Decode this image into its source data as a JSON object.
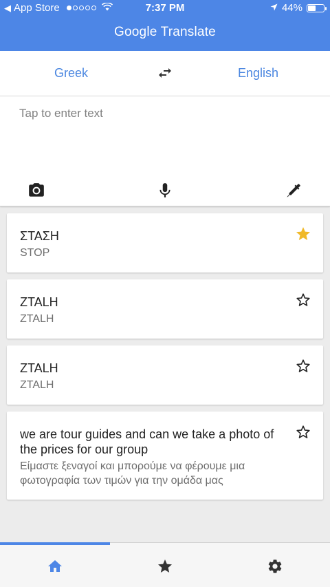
{
  "status_bar": {
    "carrier": "App Store",
    "time": "7:37 PM",
    "battery": "44%",
    "battery_level": 0.44,
    "signal_bars_filled": 1,
    "signal_bars_total": 5
  },
  "app": {
    "title": "Google Translate"
  },
  "languages": {
    "source": "Greek",
    "target": "English"
  },
  "input": {
    "placeholder": "Tap to enter text"
  },
  "tools": {
    "camera_icon": "camera-icon",
    "mic_icon": "microphone-icon",
    "handwriting_icon": "pen-icon"
  },
  "history": [
    {
      "source": "ΣΤΑΣΗ",
      "translation": "STOP",
      "starred": true
    },
    {
      "source": "ΖΤΑLΗ",
      "translation": "ZTALH",
      "starred": false
    },
    {
      "source": "ZTALH",
      "translation": "ZTALH",
      "starred": false
    },
    {
      "source": "we are tour guides and can we take a photo of the prices for our group",
      "translation": "Είμαστε ξεναγοί και μπορούμε να φέρουμε μια φωτογραφία των τιμών για την ομάδα μας",
      "starred": false
    }
  ],
  "nav": {
    "active_tab": "home",
    "tabs": [
      "home-icon",
      "star-icon",
      "gear-icon"
    ]
  },
  "colors": {
    "brand_blue": "#4d86e6",
    "language_blue": "#4a86e0",
    "star_gold": "#f0b929",
    "nav_active": "#4d86e6",
    "nav_inactive": "#333333"
  }
}
